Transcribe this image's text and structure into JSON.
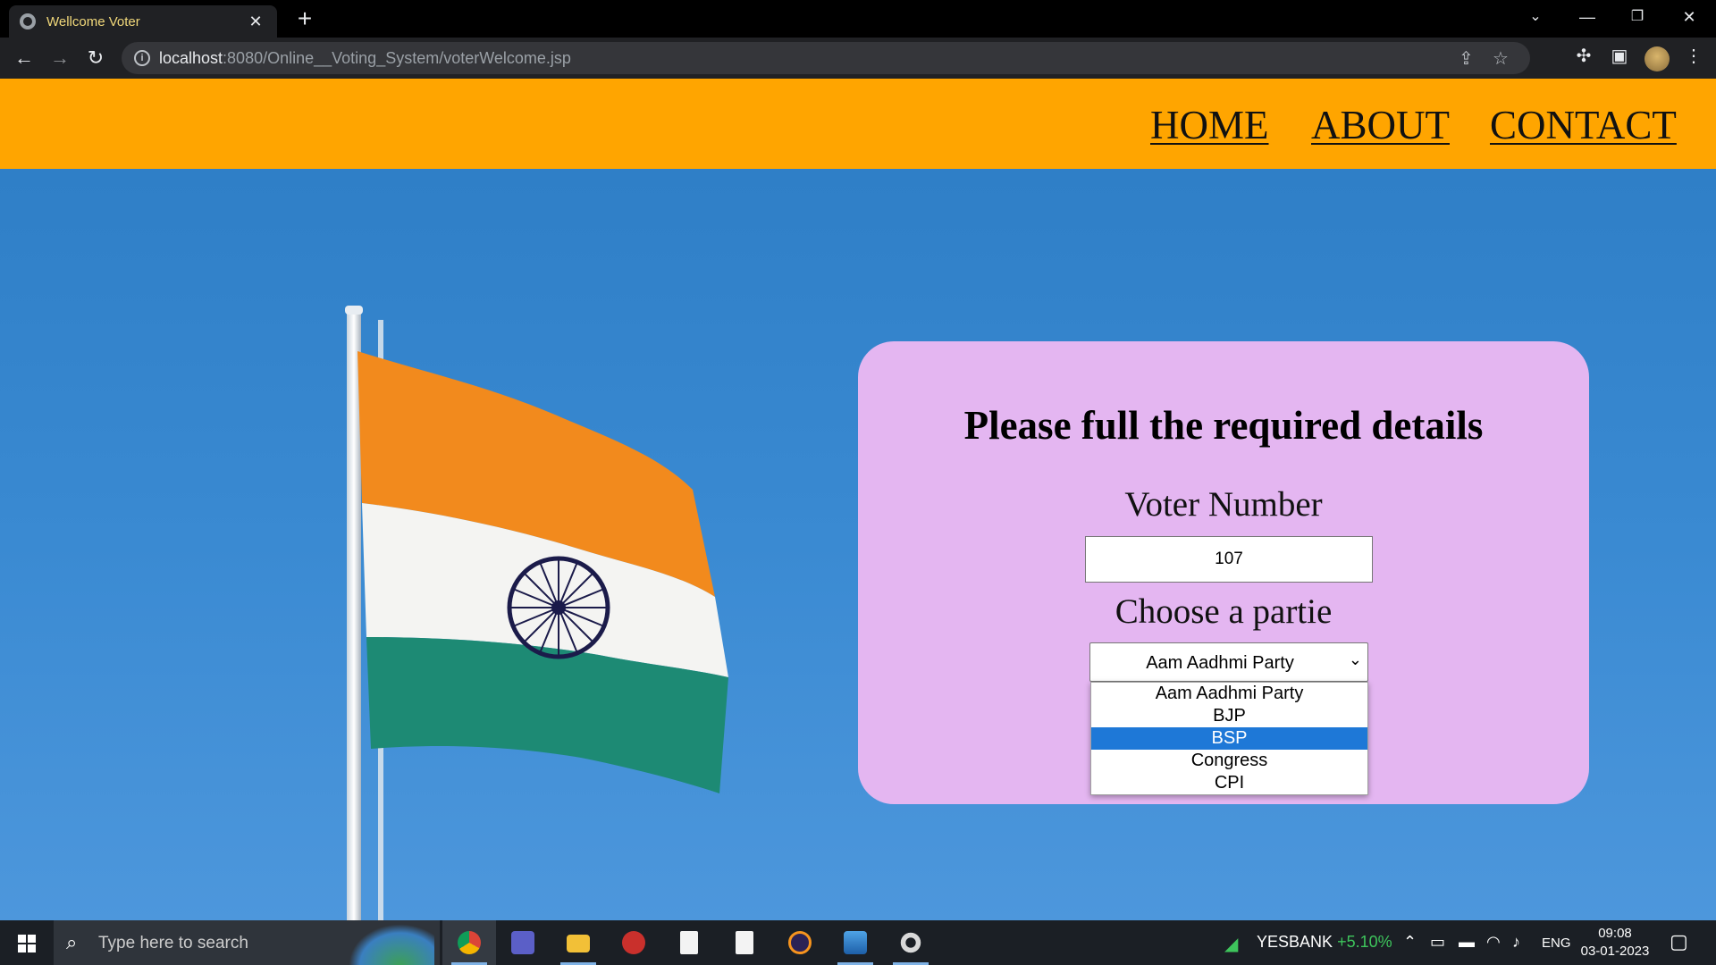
{
  "browser": {
    "tab_title": "Wellcome Voter",
    "url_host": "localhost",
    "url_path": ":8080/Online__Voting_System/voterWelcome.jsp"
  },
  "nav": {
    "links": [
      "HOME",
      "ABOUT",
      "CONTACT"
    ],
    "background_color": "#ffa500"
  },
  "form": {
    "heading": "Please full the required details",
    "voter_label": "Voter Number",
    "voter_value": "107",
    "party_label": "Choose a partie",
    "selected_party": "Aam Aadhmi Party",
    "party_options": [
      "Aam Aadhmi Party",
      "BJP",
      "BSP",
      "Congress",
      "CPI"
    ],
    "highlighted_option": "BSP",
    "card_color": "#e4b6f1"
  },
  "taskbar": {
    "search_placeholder": "Type here to search",
    "stock_name": "YESBANK",
    "stock_change": "+5.10%",
    "language": "ENG",
    "time": "09:08",
    "date": "03-01-2023"
  }
}
